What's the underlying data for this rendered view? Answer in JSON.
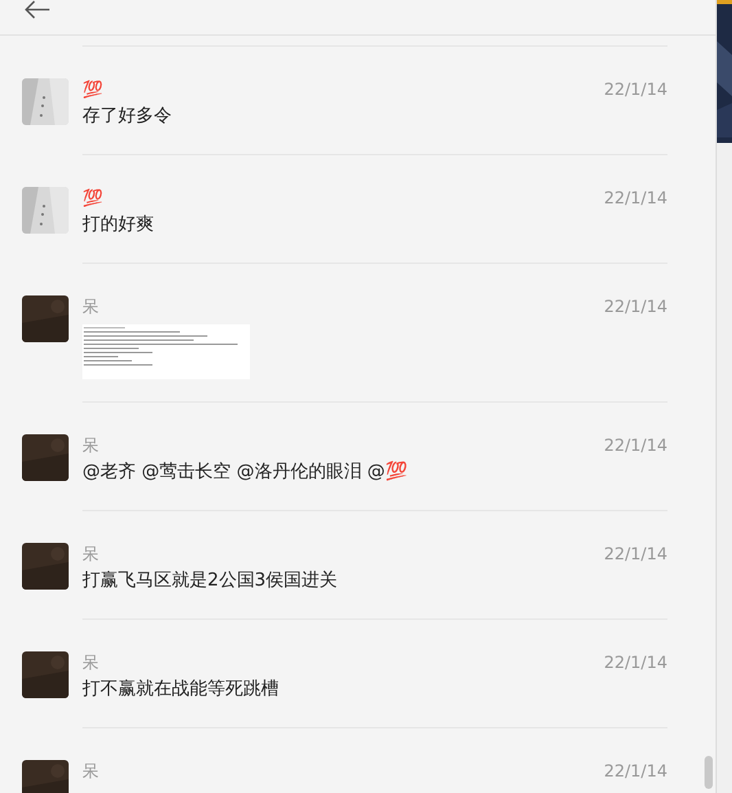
{
  "messages": [
    {
      "avatar": {
        "kind": "snow"
      },
      "name": "💯",
      "time": "22/1/14",
      "kind": "text",
      "text": "存了好多令"
    },
    {
      "avatar": {
        "kind": "snow"
      },
      "name": "💯",
      "time": "22/1/14",
      "kind": "text",
      "text": "打的好爽"
    },
    {
      "avatar": {
        "kind": "dark"
      },
      "name": "呆",
      "time": "22/1/14"
    },
    {
      "avatar": {
        "kind": "dark"
      },
      "name": "呆",
      "time": "22/1/14",
      "kind": "text",
      "text": "@老齐 @莺击长空 @洛丹伦的眼泪 @💯"
    },
    {
      "avatar": {
        "kind": "dark"
      },
      "name": "呆",
      "time": "22/1/14",
      "kind": "text",
      "text": "打赢飞马区就是2公国3侯国进关"
    },
    {
      "avatar": {
        "kind": "dark"
      },
      "name": "呆",
      "time": "22/1/14",
      "kind": "text",
      "text": "打不赢就在战能等死跳槽"
    },
    {
      "avatar": {
        "kind": "dark"
      },
      "name": "呆",
      "time": "22/1/14",
      "kind": "cut"
    }
  ]
}
